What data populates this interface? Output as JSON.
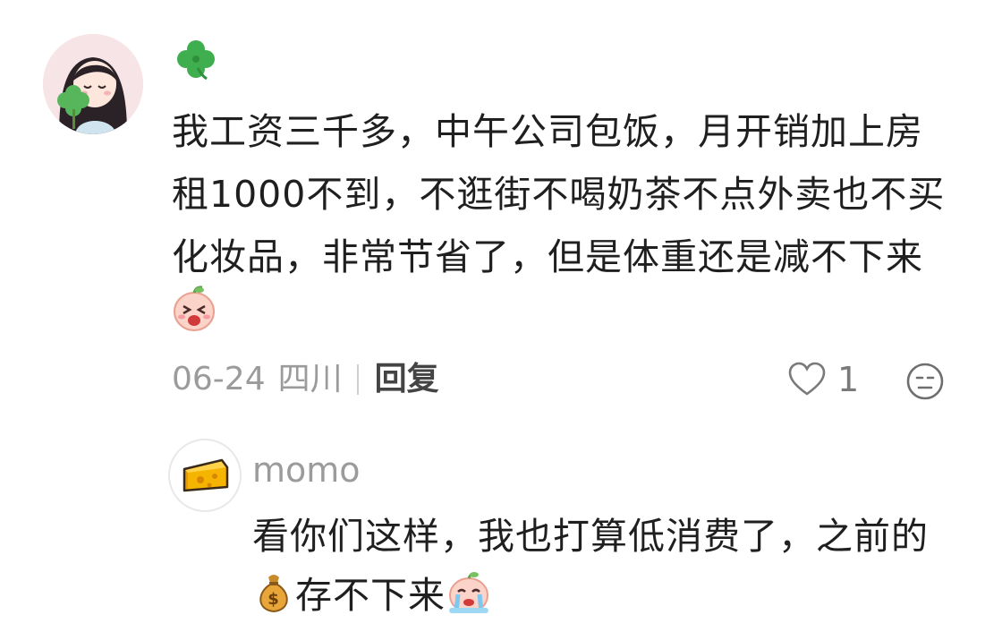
{
  "comment": {
    "username_icon": "four-leaf-clover-icon",
    "text_lines": [
      "我工资三千多，中午公司包饭，月开销加上房",
      "租1000不到，不逛街不喝奶茶不点外卖也不买",
      "化妆品，非常节省了，但是体重还是减不下来"
    ],
    "trailing_emoji": "screaming-face-emoji",
    "date": "06-24",
    "location": "四川",
    "reply_label": "回复",
    "likes": "1"
  },
  "reply": {
    "avatar_icon": "cheese-icon",
    "username": "momo",
    "text_line1": "看你们这样，我也打算低消费了，之前的",
    "text_line2_pre_emoji": "money-bag-emoji",
    "text_line2": "存不下来",
    "text_line2_post_emoji": "crying-face-emoji"
  },
  "colors": {
    "text": "#1f1f1f",
    "meta": "#9b9b9b",
    "clover": "#3fae4f",
    "cheese": "#f5b400"
  }
}
